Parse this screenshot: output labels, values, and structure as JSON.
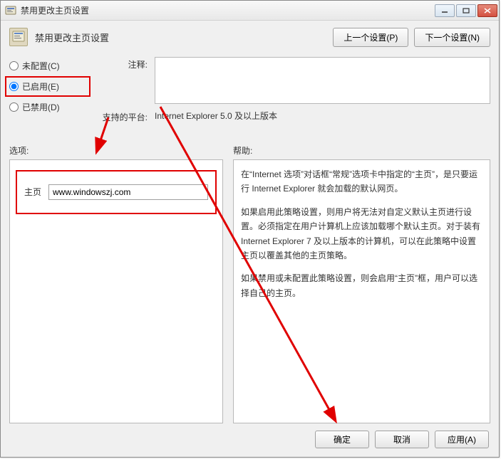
{
  "window": {
    "title": "禁用更改主页设置"
  },
  "header": {
    "page_title": "禁用更改主页设置",
    "prev_button": "上一个设置(P)",
    "next_button": "下一个设置(N)"
  },
  "radios": {
    "not_configured": "未配置(C)",
    "enabled": "已启用(E)",
    "disabled": "已禁用(D)",
    "selected": "enabled"
  },
  "config": {
    "comment_label": "注释:",
    "comment_value": "",
    "platform_label": "支持的平台:",
    "platform_value": "Internet Explorer 5.0 及以上版本"
  },
  "options": {
    "section_label": "选项:",
    "homepage_label": "主页",
    "homepage_value": "www.windowszj.com"
  },
  "help": {
    "section_label": "帮助:",
    "p1": "在“Internet 选项”对话框“常规”选项卡中指定的“主页”，是只要运行 Internet Explorer 就会加载的默认网页。",
    "p2": "如果启用此策略设置，则用户将无法对自定义默认主页进行设置。必须指定在用户计算机上应该加载哪个默认主页。对于装有 Internet Explorer 7 及以上版本的计算机，可以在此策略中设置主页以覆盖其他的主页策略。",
    "p3": "如果禁用或未配置此策略设置，则会启用“主页”框，用户可以选择自己的主页。"
  },
  "footer": {
    "ok": "确定",
    "cancel": "取消",
    "apply": "应用(A)"
  },
  "annotations": {
    "color": "#e00000"
  }
}
